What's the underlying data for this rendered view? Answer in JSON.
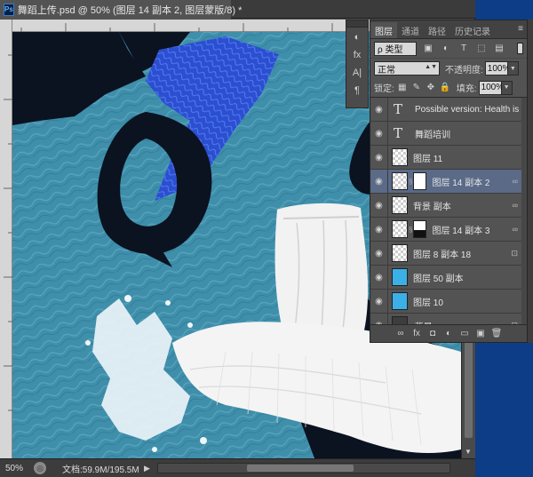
{
  "document": {
    "ps_logo": "Ps",
    "tab_title": "舞蹈上传.psd @ 50% (图层 14 副本 2, 图层蒙版/8) *",
    "close_glyph": "×"
  },
  "status": {
    "zoom": "50%",
    "doc_info": "文档:59.9M/195.5M",
    "arrow": "▶"
  },
  "tools": [
    "◐",
    "fx",
    "A|",
    "¶"
  ],
  "layers_panel": {
    "tabs": [
      "图层",
      "通道",
      "路径",
      "历史记录"
    ],
    "menu_glyph": "≡",
    "filter_kind": "ρ 类型",
    "filter_icons": [
      "▣",
      "◐",
      "T",
      "⬚",
      "▤"
    ],
    "blend_mode": "正常",
    "opacity_label": "不透明度:",
    "opacity_value": "100%",
    "lock_label": "锁定:",
    "lock_icons": [
      "▦",
      "✎",
      "✥",
      "🔒"
    ],
    "fill_label": "填充:",
    "fill_value": "100%",
    "layers": [
      {
        "name": "Possible version: Health is f...",
        "kind": "text"
      },
      {
        "name": "舞蹈培训",
        "kind": "text"
      },
      {
        "name": "图层 11",
        "kind": "pixel"
      },
      {
        "name": "图层 14 副本 2",
        "kind": "masked",
        "selected": true
      },
      {
        "name": "背景 副本",
        "kind": "pixel"
      },
      {
        "name": "图层 14 副本 3",
        "kind": "masked"
      },
      {
        "name": "图层 8 副本 18",
        "kind": "pixel"
      },
      {
        "name": "图层 50 副本",
        "kind": "color"
      },
      {
        "name": "图层 10",
        "kind": "color"
      },
      {
        "name": "背景",
        "kind": "background"
      }
    ],
    "footer_icons": [
      "∞",
      "fx",
      "◘",
      "◐",
      "▭",
      "▣",
      "🗑"
    ]
  },
  "colors": {
    "canvas_blue": "#3f8fab",
    "dark_blob": "#0b1220",
    "royal_blue": "#2a4fd0",
    "selected_row": "#5a6a87",
    "desktop": "#0d3d86"
  }
}
